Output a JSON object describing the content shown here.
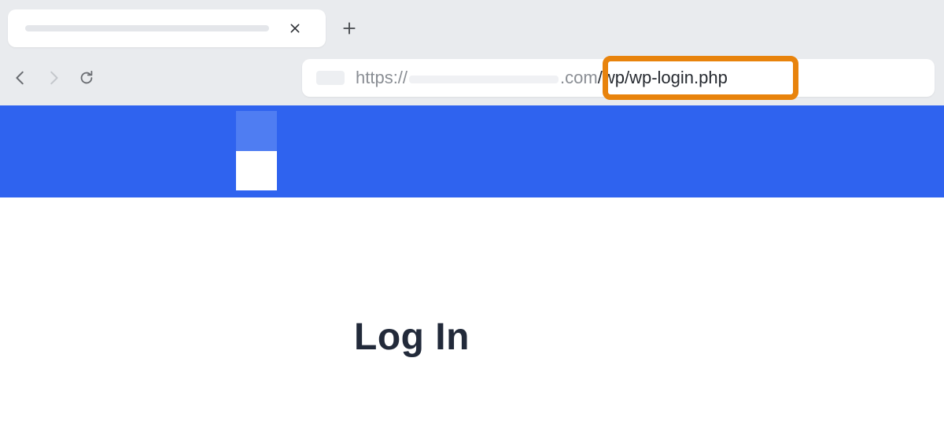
{
  "browser": {
    "url": {
      "scheme": "https://",
      "tld": ".com",
      "path": "/wp/wp-login.php"
    }
  },
  "page": {
    "title": "Log In"
  }
}
